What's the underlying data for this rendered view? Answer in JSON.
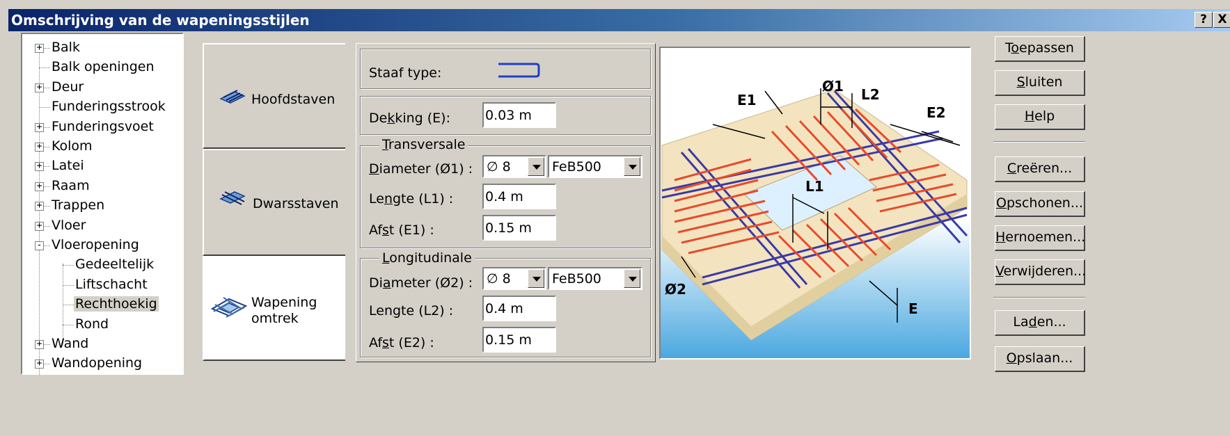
{
  "window": {
    "title": "Omschrijving van de wapeningsstijlen",
    "help_label": "?",
    "close_label": "X"
  },
  "tree": {
    "items": [
      {
        "label": "Balk",
        "expander": "+"
      },
      {
        "label": "Balk openingen",
        "expander": ""
      },
      {
        "label": "Deur",
        "expander": "+"
      },
      {
        "label": "Funderingsstrook",
        "expander": ""
      },
      {
        "label": "Funderingsvoet",
        "expander": "+"
      },
      {
        "label": "Kolom",
        "expander": "+"
      },
      {
        "label": "Latei",
        "expander": "+"
      },
      {
        "label": "Raam",
        "expander": "+"
      },
      {
        "label": "Trappen",
        "expander": "+"
      },
      {
        "label": "Vloer",
        "expander": "+"
      },
      {
        "label": "Vloeropening",
        "expander": "-"
      },
      {
        "label": "Gedeeltelijk",
        "expander": ""
      },
      {
        "label": "Liftschacht",
        "expander": ""
      },
      {
        "label": "Rechthoekig",
        "expander": "",
        "selected": true
      },
      {
        "label": "Rond",
        "expander": ""
      },
      {
        "label": "Wand",
        "expander": "+"
      },
      {
        "label": "Wandopening",
        "expander": "+"
      }
    ]
  },
  "tabs": [
    {
      "label": "Hoofdstaven",
      "icon": "main-bars-icon"
    },
    {
      "label": "Dwarsstaven",
      "icon": "cross-bars-icon"
    },
    {
      "label_line1": "Wapening",
      "label_line2": "omtrek",
      "icon": "perimeter-reinforcement-icon",
      "active": true
    }
  ],
  "form": {
    "staaf_type_label": "Staaf type:",
    "staaf_type_icon": "bar-shape-icon",
    "dekking_label_pre": "De",
    "dekking_label_u": "k",
    "dekking_label_post": "king (E):",
    "dekking_value": "0.03 m",
    "transversale": {
      "legend_u": "T",
      "legend_rest": "ransversale",
      "diameter_label_u": "D",
      "diameter_label_rest": "iameter (Ø1) :",
      "diameter_value": "∅ 8",
      "steel_value": "FeB500",
      "lengte_label_pre": "Le",
      "lengte_label_u": "n",
      "lengte_label_post": "gte (L1) :",
      "lengte_value": "0.4 m",
      "afst_label_pre": "Af",
      "afst_label_u": "s",
      "afst_label_post": "t (E1) :",
      "afst_value": "0.15 m"
    },
    "longitudinale": {
      "legend_u": "L",
      "legend_rest": "ongitudinale",
      "diameter_label_pre": "Di",
      "diameter_label_u": "a",
      "diameter_label_post": "meter (Ø2) :",
      "diameter_value": "∅ 8",
      "steel_value": "FeB500",
      "lengte_label_pre": "Len",
      "lengte_label_u": "g",
      "lengte_label_post": "te (L2) :",
      "lengte_value": "0.4 m",
      "afst_label_pre": "Af",
      "afst_label_u": "s",
      "afst_label_post": "t (E2) :",
      "afst_value": "0.15 m"
    }
  },
  "illustration": {
    "labels": {
      "e1": "E1",
      "d1": "Ø1",
      "l2": "L2",
      "e2": "E2",
      "l1": "L1",
      "d2": "Ø2",
      "e": "E"
    },
    "colors": {
      "bars_red": "#e84a2a",
      "bars_blue": "#3a3aa8",
      "slab": "#f5e8c8",
      "sky": "#4aa8e0"
    }
  },
  "buttons": [
    {
      "pre": "T",
      "u": "o",
      "post": "epassen"
    },
    {
      "pre": "",
      "u": "S",
      "post": "luiten"
    },
    {
      "pre": "",
      "u": "H",
      "post": "elp"
    },
    {
      "pre": "",
      "u": "C",
      "post": "reëren..."
    },
    {
      "pre": "",
      "u": "O",
      "post": "pschonen..."
    },
    {
      "pre": "",
      "u": "H",
      "post": "ernoemen..."
    },
    {
      "pre": "",
      "u": "V",
      "post": "erwijderen..."
    },
    {
      "pre": "La",
      "u": "d",
      "post": "en..."
    },
    {
      "pre": "",
      "u": "O",
      "post": "pslaan..."
    }
  ]
}
